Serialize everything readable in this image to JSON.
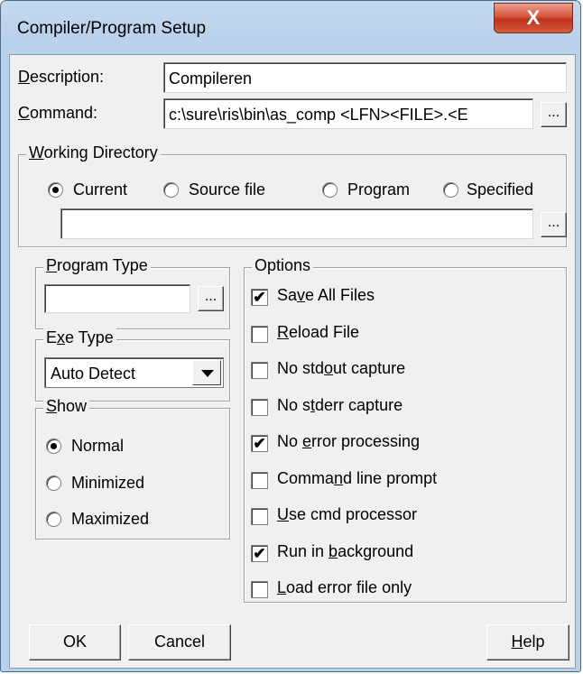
{
  "window": {
    "title": "Compiler/Program Setup",
    "close_glyph": "X"
  },
  "description": {
    "label_pre": "",
    "label_mn": "D",
    "label_post": "escription:",
    "value": "Compileren"
  },
  "command": {
    "label_pre": "",
    "label_mn": "C",
    "label_post": "ommand:",
    "value": "c:\\sure\\ris\\bin\\as_comp <LFN><FILE>.<E",
    "browse": "..."
  },
  "working_dir": {
    "label_pre": "",
    "label_mn": "W",
    "label_post": "orking Directory",
    "options": [
      "Current",
      "Source file",
      "Program",
      "Specified"
    ],
    "selected": "Current",
    "path_value": "",
    "browse": "..."
  },
  "program_type": {
    "label_pre": "",
    "label_mn": "P",
    "label_post": "rogram Type",
    "value": "",
    "browse": "..."
  },
  "exe_type": {
    "label_pre": "E",
    "label_mn": "x",
    "label_post": "e Type",
    "value": "Auto Detect"
  },
  "show": {
    "label_pre": "",
    "label_mn": "S",
    "label_post": "how",
    "options": [
      "Normal",
      "Minimized",
      "Maximized"
    ],
    "selected": "Normal"
  },
  "options": {
    "label": "Options",
    "items": [
      {
        "pre": "Sa",
        "mn": "v",
        "post": "e All Files",
        "checked": true
      },
      {
        "pre": "",
        "mn": "R",
        "post": "eload File",
        "checked": false
      },
      {
        "pre": "No std",
        "mn": "o",
        "post": "ut capture",
        "checked": false
      },
      {
        "pre": "No s",
        "mn": "t",
        "post": "derr capture",
        "checked": false
      },
      {
        "pre": "No ",
        "mn": "e",
        "post": "rror processing",
        "checked": true
      },
      {
        "pre": "Comma",
        "mn": "n",
        "post": "d line prompt",
        "checked": false
      },
      {
        "pre": "",
        "mn": "U",
        "post": "se cmd processor",
        "checked": false
      },
      {
        "pre": "Run in ",
        "mn": "b",
        "post": "ackground",
        "checked": true
      },
      {
        "pre": "",
        "mn": "L",
        "post": "oad error file only",
        "checked": false
      }
    ]
  },
  "buttons": {
    "ok": "OK",
    "cancel": "Cancel",
    "help_mn": "H",
    "help_post": "elp"
  },
  "check_glyph": "✔"
}
